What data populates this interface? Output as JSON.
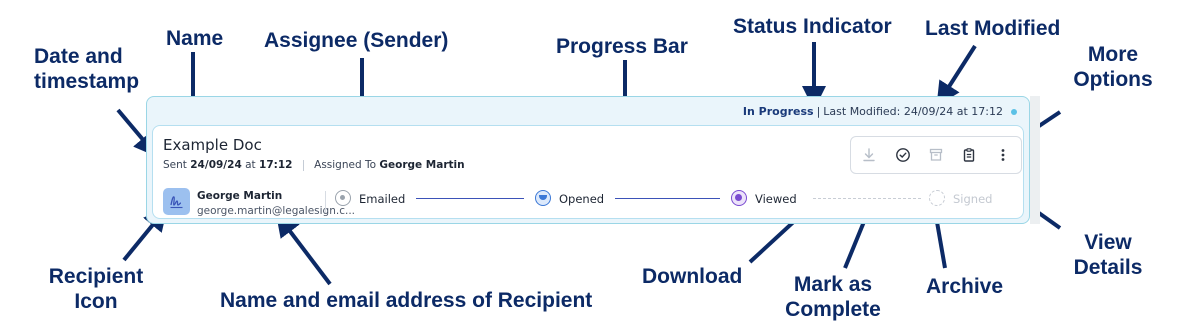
{
  "annotations": {
    "date_timestamp": "Date and timestamp",
    "name": "Name",
    "assignee": "Assignee (Sender)",
    "progress_bar": "Progress Bar",
    "status_indicator": "Status Indicator",
    "last_modified": "Last Modified",
    "more_options": "More Options",
    "recipient_icon": "Recipient Icon",
    "recipient_info": "Name and email address of Recipient",
    "download": "Download",
    "mark_complete": "Mark as Complete",
    "archive": "Archive",
    "view_details": "View Details"
  },
  "card": {
    "status": "In Progress",
    "last_modified_label": "Last Modified:",
    "last_modified_value": "24/09/24 at 17:12",
    "doc_name": "Example Doc",
    "sent_label": "Sent",
    "sent_date": "24/09/24",
    "sent_at": "at",
    "sent_time": "17:12",
    "assigned_label": "Assigned To",
    "assignee": "George Martin",
    "recipient": {
      "name": "George Martin",
      "email": "george.martin@legalesign.c..."
    },
    "steps": [
      {
        "label": "Emailed",
        "state": "done"
      },
      {
        "label": "Opened",
        "state": "done"
      },
      {
        "label": "Viewed",
        "state": "done"
      },
      {
        "label": "Signed",
        "state": "pending"
      }
    ],
    "actions": [
      "download-icon",
      "check-circle-icon",
      "archive-icon",
      "clipboard-icon",
      "kebab-icon"
    ]
  },
  "colors": {
    "annotation": "#0c2a66",
    "emailed": "#9aa3ad",
    "opened": "#3b78d6",
    "viewed": "#7a4bd1",
    "line_done": "#3b52b8"
  }
}
